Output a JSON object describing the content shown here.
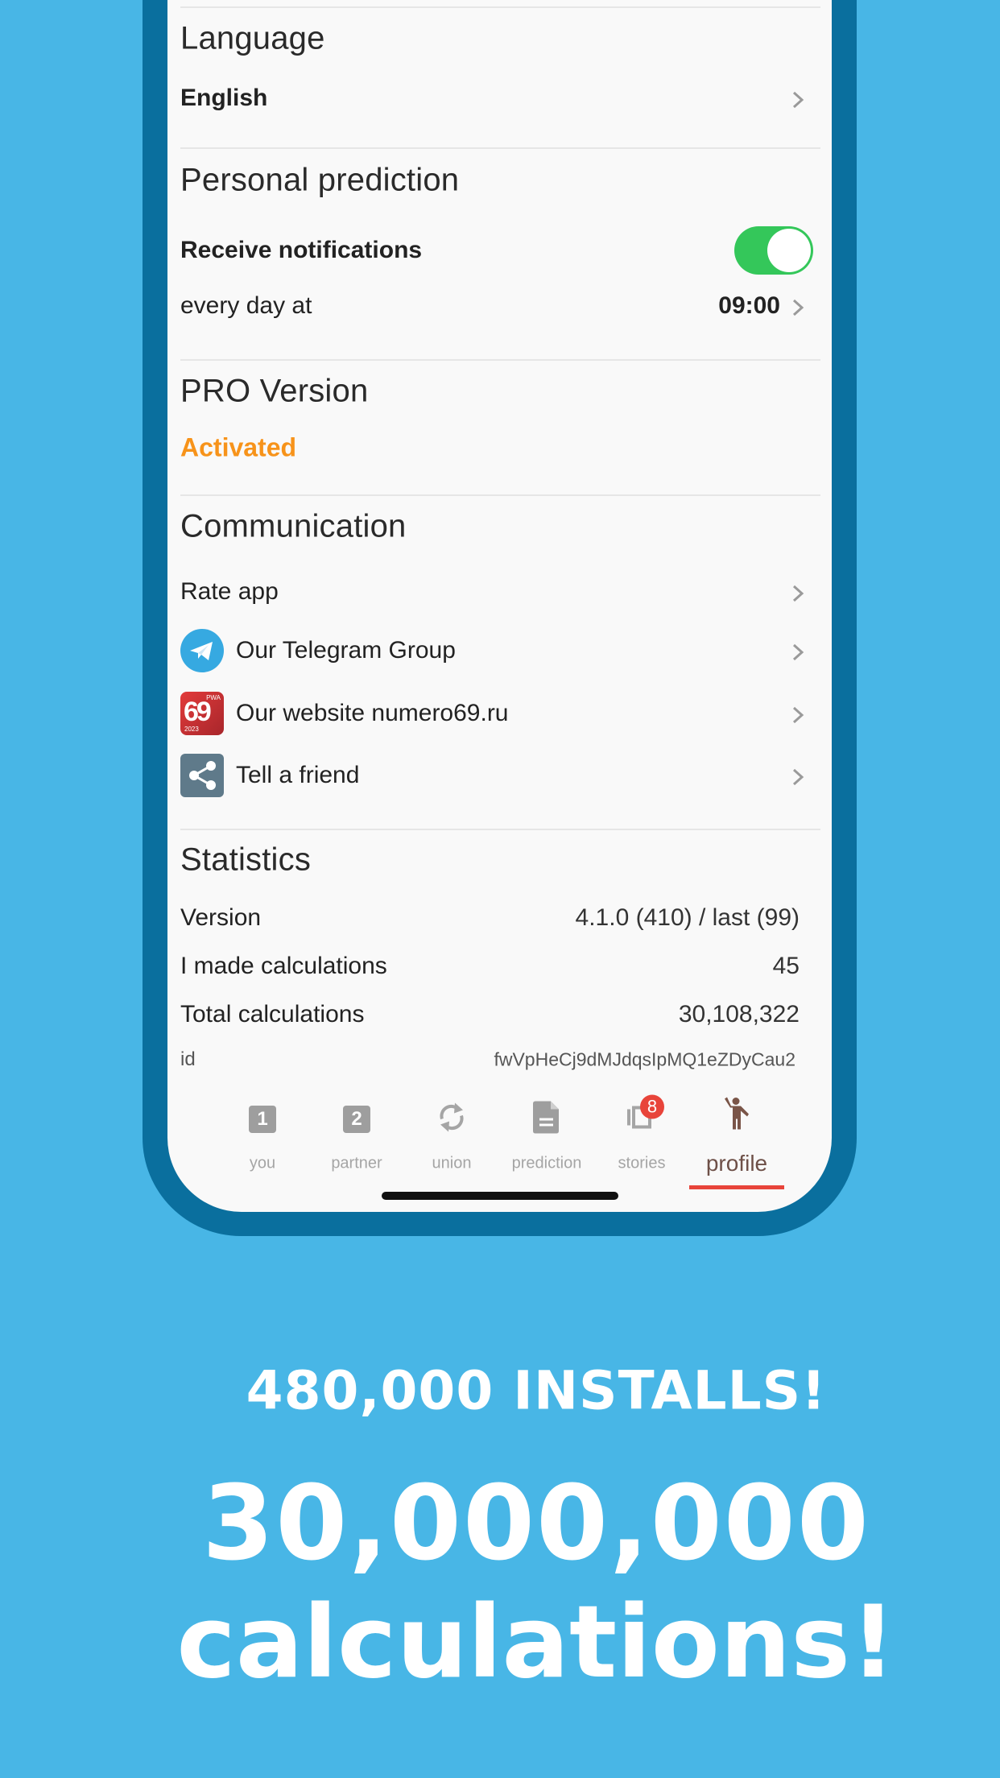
{
  "colors": {
    "background": "#48b6e6",
    "frame": "#0a6f9e",
    "screen": "#f9f9f9",
    "accent_orange": "#f7931a",
    "toggle_on": "#34c75a",
    "badge_red": "#e8443a",
    "nav_active": "#6e5048",
    "nav_underline": "#e8443a"
  },
  "settings": {
    "language": {
      "title": "Language",
      "value": "English"
    },
    "personal_prediction": {
      "title": "Personal prediction",
      "receive_notifications_label": "Receive notifications",
      "receive_notifications_on": true,
      "schedule_label": "every day at",
      "schedule_time": "09:00"
    },
    "pro_version": {
      "title": "PRO Version",
      "status": "Activated"
    },
    "communication": {
      "title": "Communication",
      "items": [
        {
          "label": "Rate app",
          "icon": "none"
        },
        {
          "label": "Our Telegram Group",
          "icon": "telegram-icon"
        },
        {
          "label": "Our website numero69.ru",
          "icon": "numero69-logo-icon",
          "logo_text": "69",
          "logo_small_top": "PWA",
          "logo_small_bottom": "2023"
        },
        {
          "label": "Tell a friend",
          "icon": "share-icon"
        }
      ]
    },
    "statistics": {
      "title": "Statistics",
      "rows": [
        {
          "label": "Version",
          "value": "4.1.0 (410) / last (99)"
        },
        {
          "label": "I made calculations",
          "value": "45"
        },
        {
          "label": "Total calculations",
          "value": "30,108,322"
        },
        {
          "label": "id",
          "value": "fwVpHeCj9dMJdqsIpMQ1eZDyCau2"
        }
      ]
    }
  },
  "bottom_nav": {
    "items": [
      {
        "label": "you",
        "icon": "number-1-icon",
        "glyph": "1",
        "active": false
      },
      {
        "label": "partner",
        "icon": "number-2-icon",
        "glyph": "2",
        "active": false
      },
      {
        "label": "union",
        "icon": "sync-icon",
        "active": false
      },
      {
        "label": "prediction",
        "icon": "document-icon",
        "active": false
      },
      {
        "label": "stories",
        "icon": "stories-icon",
        "badge": "8",
        "active": false
      },
      {
        "label": "profile",
        "icon": "person-waving-icon",
        "active": true
      }
    ]
  },
  "promo": {
    "installs": "480,000 INSTALLS!",
    "calculations_number": "30,000,000",
    "calculations_word": "calculations!"
  }
}
